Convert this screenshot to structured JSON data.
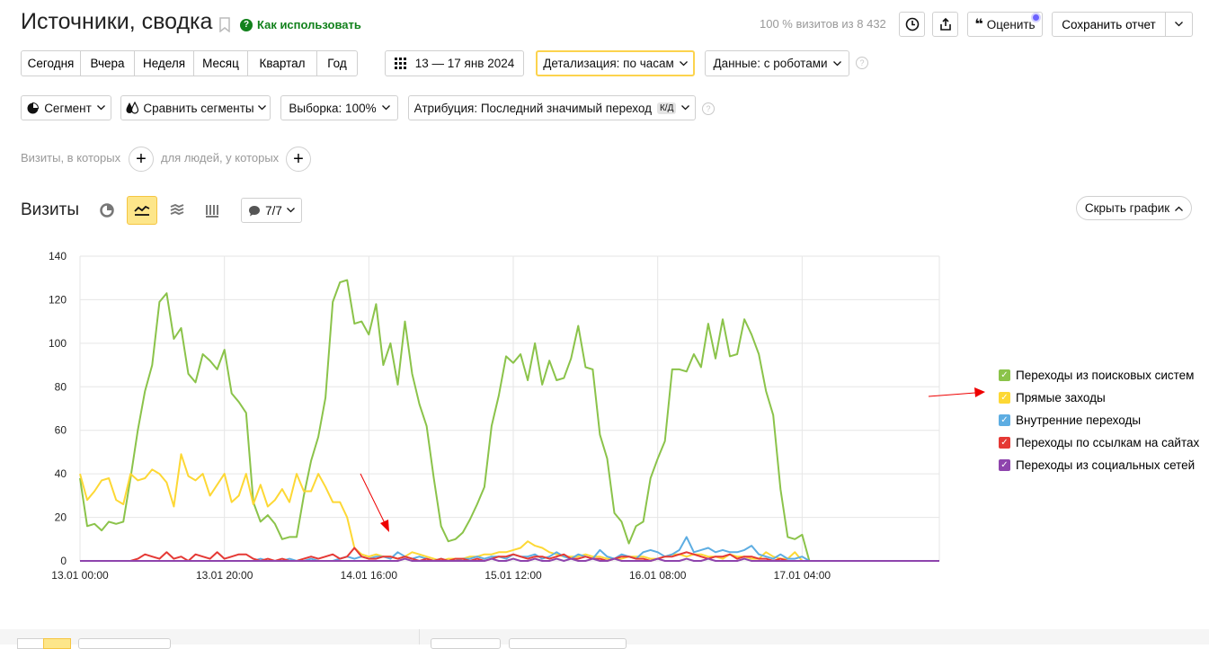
{
  "header": {
    "title": "Источники, сводка",
    "howto_label": "Как использовать",
    "visits_share": "100 % визитов из 8 432",
    "rate_label": "Оценить",
    "save_report_label": "Сохранить отчет"
  },
  "period": {
    "buttons": [
      "Сегодня",
      "Вчера",
      "Неделя",
      "Месяц",
      "Квартал",
      "Год"
    ],
    "date_range": "13 — 17 янв 2024",
    "detail": "Детализация: по часам",
    "data": "Данные: с роботами"
  },
  "filters": {
    "segment": "Сегмент",
    "compare": "Сравнить сегменты",
    "sample": "Выборка: 100%",
    "attribution": "Атрибуция: Последний значимый переход",
    "attribution_badge": "К/Д"
  },
  "conditions": {
    "visits_label": "Визиты, в которых",
    "people_label": "для людей, у которых"
  },
  "chart_header": {
    "title": "Визиты",
    "series_count": "7/7",
    "hide_label": "Скрыть график"
  },
  "chart_data": {
    "type": "line",
    "ylim": [
      0,
      140
    ],
    "yticks": [
      "0",
      "20",
      "40",
      "60",
      "80",
      "100",
      "120",
      "140"
    ],
    "xticks": [
      "13.01 00:00",
      "13.01 20:00",
      "14.01 16:00",
      "15.01 12:00",
      "16.01 08:00",
      "17.01 04:00"
    ],
    "grid": true,
    "legend_position": "right",
    "series": [
      {
        "name": "Переходы из поисковых систем",
        "color": "#8bc34a",
        "values": [
          38,
          16,
          17,
          14,
          18,
          17,
          18,
          38,
          60,
          78,
          90,
          119,
          123,
          102,
          107,
          86,
          82,
          95,
          92,
          88,
          97,
          77,
          73,
          68,
          27,
          18,
          21,
          17,
          10,
          11,
          11,
          30,
          46,
          57,
          75,
          119,
          128,
          129,
          109,
          110,
          104,
          118,
          90,
          100,
          81,
          110,
          86,
          72,
          62,
          38,
          16,
          9,
          10,
          13,
          19,
          26,
          34,
          62,
          76,
          94,
          91,
          95,
          83,
          100,
          81,
          92,
          83,
          84,
          93,
          108,
          89,
          88,
          58,
          47,
          22,
          18,
          8,
          16,
          18,
          38,
          47,
          55,
          88,
          88,
          87,
          95,
          89,
          109,
          93,
          111,
          94,
          95,
          111,
          104,
          95,
          78,
          67,
          33,
          11,
          10,
          12,
          0
        ]
      },
      {
        "name": "Прямые заходы",
        "color": "#fdd835",
        "values": [
          40,
          28,
          32,
          37,
          38,
          28,
          26,
          40,
          37,
          38,
          42,
          40,
          36,
          25,
          49,
          39,
          37,
          40,
          30,
          35,
          40,
          27,
          30,
          40,
          26,
          35,
          25,
          28,
          33,
          27,
          40,
          32,
          32,
          40,
          34,
          27,
          27,
          20,
          6,
          3,
          2,
          3,
          2,
          2,
          1,
          2,
          4,
          3,
          2,
          1,
          0,
          1,
          1,
          1,
          2,
          2,
          3,
          3,
          4,
          4,
          5,
          6,
          9,
          7,
          6,
          4,
          3,
          2,
          2,
          2,
          3,
          2,
          2,
          1,
          1,
          1,
          2,
          2,
          2,
          1,
          1,
          2,
          3,
          3,
          2,
          3,
          3,
          2,
          2,
          1,
          3,
          2,
          2,
          1,
          1,
          4,
          2,
          1,
          1,
          4,
          0,
          0
        ]
      },
      {
        "name": "Внутренние переходы",
        "color": "#5dade2",
        "values": [
          0,
          0,
          0,
          0,
          0,
          0,
          0,
          0,
          0,
          0,
          0,
          0,
          0,
          0,
          0,
          0,
          0,
          0,
          0,
          0,
          0,
          0,
          0,
          0,
          0,
          1,
          0,
          0,
          0,
          1,
          0,
          0,
          1,
          0,
          0,
          0,
          1,
          2,
          1,
          2,
          1,
          2,
          2,
          1,
          4,
          2,
          1,
          2,
          1,
          0,
          1,
          0,
          0,
          1,
          1,
          2,
          1,
          2,
          2,
          1,
          3,
          2,
          2,
          3,
          1,
          2,
          4,
          2,
          1,
          3,
          2,
          1,
          5,
          2,
          1,
          3,
          2,
          1,
          4,
          5,
          4,
          2,
          3,
          5,
          11,
          4,
          5,
          6,
          4,
          5,
          4,
          4,
          5,
          7,
          3,
          2,
          1,
          3,
          1,
          1,
          2,
          0
        ]
      },
      {
        "name": "Переходы по ссылкам на сайтах",
        "color": "#e53935",
        "values": [
          0,
          0,
          0,
          0,
          0,
          0,
          0,
          0,
          1,
          3,
          2,
          1,
          4,
          1,
          2,
          0,
          3,
          2,
          1,
          4,
          1,
          2,
          3,
          3,
          1,
          0,
          1,
          0,
          1,
          0,
          0,
          1,
          2,
          1,
          2,
          3,
          1,
          2,
          6,
          2,
          1,
          1,
          2,
          2,
          1,
          2,
          1,
          0,
          1,
          0,
          1,
          0,
          1,
          1,
          0,
          1,
          0,
          1,
          2,
          2,
          3,
          2,
          1,
          2,
          2,
          1,
          2,
          3,
          1,
          1,
          2,
          1,
          1,
          0,
          1,
          2,
          2,
          1,
          1,
          0,
          1,
          2,
          2,
          3,
          4,
          3,
          2,
          1,
          2,
          2,
          3,
          1,
          2,
          2,
          1,
          1,
          0,
          1,
          0,
          0,
          0,
          0
        ]
      },
      {
        "name": "Переходы из социальных сетей",
        "color": "#8e44ad",
        "values": [
          0,
          0,
          0,
          0,
          0,
          0,
          0,
          0,
          0,
          0,
          0,
          0,
          0,
          0,
          0,
          0,
          0,
          0,
          0,
          0,
          0,
          0,
          0,
          0,
          0,
          0,
          0,
          0,
          0,
          0,
          0,
          0,
          0,
          0,
          0,
          0,
          0,
          0,
          0,
          0,
          0,
          0,
          0,
          0,
          0,
          1,
          0,
          0,
          0,
          0,
          0,
          0,
          0,
          0,
          0,
          0,
          0,
          1,
          0,
          0,
          1,
          0,
          0,
          1,
          0,
          0,
          1,
          0,
          1,
          0,
          0,
          1,
          0,
          0,
          1,
          0,
          0,
          0,
          0,
          0,
          1,
          0,
          0,
          0,
          1,
          0,
          0,
          1,
          0,
          0,
          0,
          0,
          1,
          0,
          0,
          0,
          0,
          0,
          0,
          0,
          0,
          0
        ]
      }
    ]
  }
}
